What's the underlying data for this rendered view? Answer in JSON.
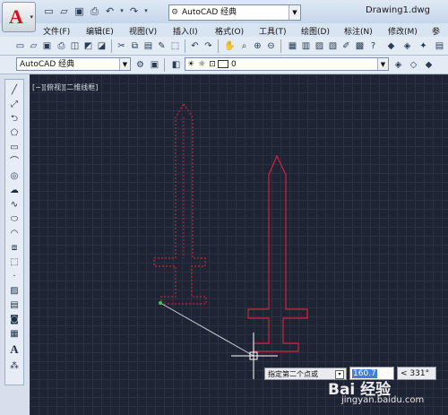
{
  "app": {
    "logo_letter": "A",
    "doc_title": "Drawing1.dwg",
    "workspace": "AutoCAD 经典"
  },
  "menu": [
    "文件(F)",
    "编辑(E)",
    "视图(V)",
    "插入(I)",
    "格式(O)",
    "工具(T)",
    "绘图(D)",
    "标注(N)",
    "修改(M)",
    "参"
  ],
  "toolbar2": {
    "style_combo": "AutoCAD 经典",
    "layer_combo": "0"
  },
  "viewport": {
    "label": "[−][俯视][二维线框]"
  },
  "dynamic_input": {
    "prompt": "指定第二个点或",
    "distance": "160.7",
    "angle": "< 331°"
  },
  "watermark": {
    "text": "Bai 经验",
    "url": "jingyan.baidu.com"
  },
  "colors": {
    "canvas": "#1e2433",
    "selected_outline": "#c0283a",
    "sword_outline": "#d0243a",
    "rubber_band": "#c8ccd4"
  },
  "icons": {
    "quick_access": [
      "new-icon",
      "open-icon",
      "save-icon",
      "print-icon",
      "undo-icon",
      "redo-icon"
    ],
    "draw_tools": [
      "line-icon",
      "construction-line-icon",
      "polyline-icon",
      "polygon-icon",
      "rectangle-icon",
      "arc-icon",
      "circle-icon",
      "revcloud-icon",
      "spline-icon",
      "ellipse-icon",
      "ellipse-arc-icon",
      "insert-block-icon",
      "make-block-icon",
      "point-icon",
      "hatch-icon",
      "gradient-icon",
      "region-icon",
      "table-icon",
      "mtext-icon",
      "add-selected-icon"
    ]
  }
}
